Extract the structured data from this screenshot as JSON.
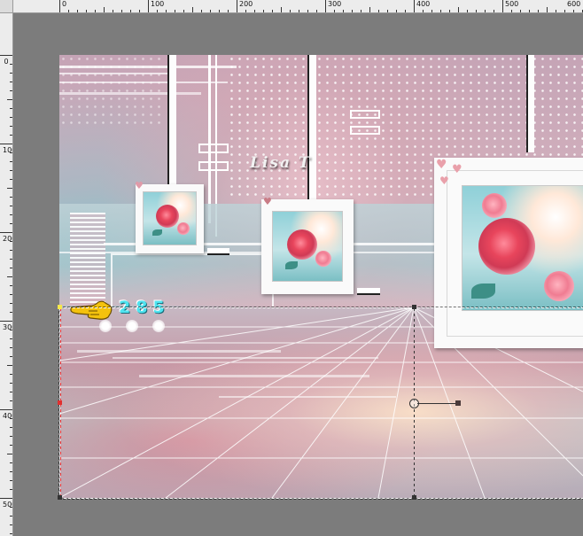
{
  "rulers": {
    "horizontal_labels": [
      "0",
      "100",
      "200",
      "300",
      "400",
      "500",
      "600"
    ],
    "vertical_labels": [
      "0",
      "100",
      "200",
      "300",
      "400",
      "500"
    ]
  },
  "artwork": {
    "signature": "Lisa T",
    "step_number": "285"
  },
  "colors": {
    "ruler_bg": "#ececec",
    "workspace_bg": "#7a7a7a",
    "step_number": "#4fe4f0",
    "pointer_hand": "#f4c20d",
    "selection_handle": "#333333"
  },
  "icons": {
    "pointer": "pointing-hand-icon",
    "frame_hearts": "heart-icon",
    "deform_handle": "rotation-handle-icon"
  }
}
